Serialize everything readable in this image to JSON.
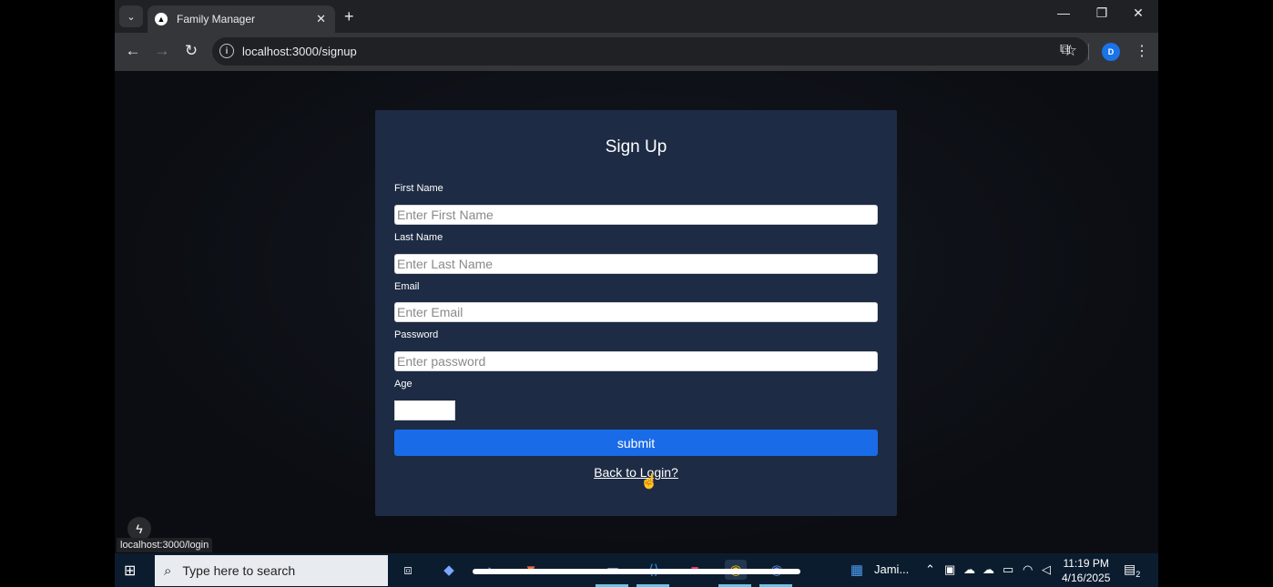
{
  "browser": {
    "tab_title": "Family Manager",
    "tab_close": "✕",
    "new_tab": "+",
    "url": "localhost:3000/signup",
    "profile_initial": "D",
    "status_url": "localhost:3000/login"
  },
  "form": {
    "title": "Sign Up",
    "first_name_label": "First Name",
    "first_name_placeholder": "Enter First Name",
    "last_name_label": "Last Name",
    "last_name_placeholder": "Enter Last Name",
    "email_label": "Email",
    "email_placeholder": "Enter Email",
    "password_label": "Password",
    "password_placeholder": "Enter password",
    "age_label": "Age",
    "submit_label": "submit",
    "back_link": "Back to Login?"
  },
  "taskbar": {
    "search_placeholder": "Type here to search",
    "weather_text": "Jami...",
    "time": "11:19 PM",
    "date": "4/16/2025",
    "notification_count": "2"
  },
  "colors": {
    "card_bg": "#1d2b44",
    "submit_bg": "#1a6be8",
    "taskbar_bg": "#0c1c2f"
  }
}
